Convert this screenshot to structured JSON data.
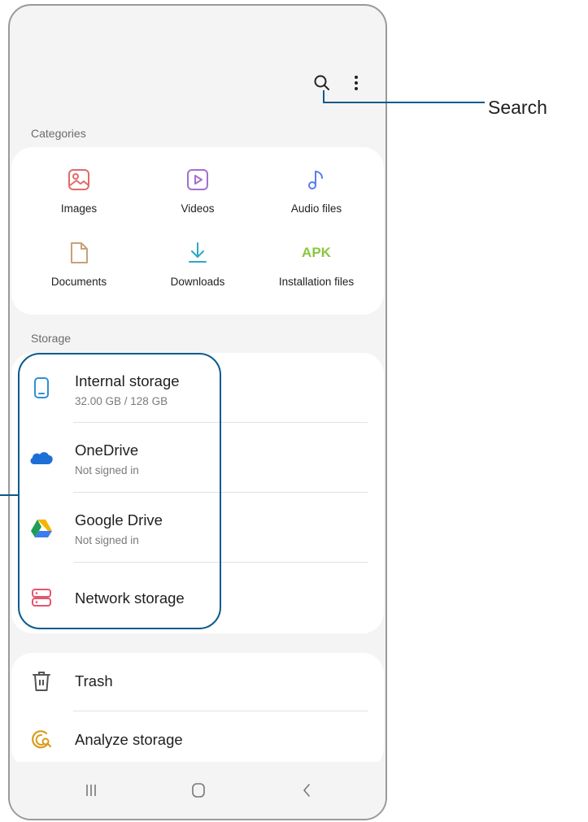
{
  "toolbar": {
    "search_icon": "search-icon",
    "more_icon": "more-options-icon"
  },
  "categories": {
    "label": "Categories",
    "items": [
      {
        "label": "Images",
        "icon": "image-icon",
        "color": "#e26a6a"
      },
      {
        "label": "Videos",
        "icon": "video-icon",
        "color": "#a46fd1"
      },
      {
        "label": "Audio files",
        "icon": "music-note-icon",
        "color": "#5c7cf0"
      },
      {
        "label": "Documents",
        "icon": "document-icon",
        "color": "#c8a177"
      },
      {
        "label": "Downloads",
        "icon": "download-icon",
        "color": "#2fa7c6"
      },
      {
        "label": "Installation files",
        "icon": "apk-icon",
        "icon_text": "APK",
        "color": "#8cc63f"
      }
    ]
  },
  "storage": {
    "label": "Storage",
    "items": [
      {
        "title": "Internal storage",
        "subtitle": "32.00 GB / 128 GB",
        "icon": "phone-icon",
        "color": "#2f8fd6"
      },
      {
        "title": "OneDrive",
        "subtitle": "Not signed in",
        "icon": "onedrive-icon",
        "color": "#1d6fd6"
      },
      {
        "title": "Google Drive",
        "subtitle": "Not signed in",
        "icon": "google-drive-icon",
        "color": "#2f9e44"
      },
      {
        "title": "Network storage",
        "subtitle": "",
        "icon": "network-storage-icon",
        "color": "#e4566e"
      }
    ]
  },
  "tools": {
    "items": [
      {
        "title": "Trash",
        "icon": "trash-icon",
        "color": "#555555"
      },
      {
        "title": "Analyze storage",
        "icon": "analyze-storage-icon",
        "color": "#d89b1a"
      }
    ]
  },
  "callouts": {
    "search_label": "Search",
    "line_color": "#0a5a8c"
  },
  "navbar": {
    "recents_icon": "recents-icon",
    "home_icon": "home-icon",
    "back_icon": "back-icon"
  }
}
